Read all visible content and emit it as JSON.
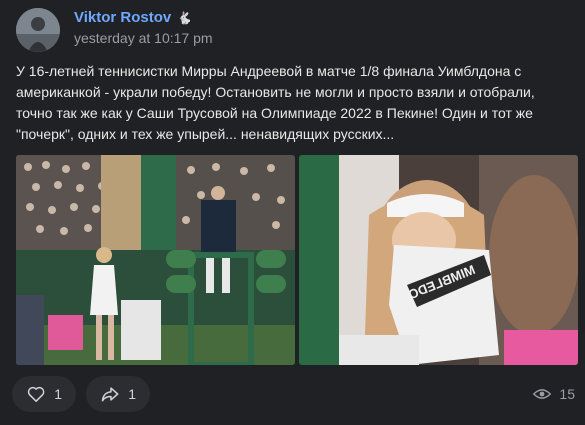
{
  "post": {
    "author": "Viktor Rostov",
    "author_badge": "🐇",
    "timestamp": "yesterday at 10:17 pm",
    "text": "У 16-летней теннисистки Мирры Андреевой в матче 1/8 финала Уимблдона с американкой - украли победу! Остановить не могли и просто взяли и отобрали, точно так же как у Саши Трусовой на Олимпиаде 2022 в Пекине! Один и тот же \"почерк\", одних и тех же упырей... ненавидящих русских...",
    "towel_text": "MIMBLEDON"
  },
  "actions": {
    "likes": "1",
    "shares": "1",
    "views": "15"
  },
  "icons": {
    "like": "heart-icon",
    "share": "share-arrow-icon",
    "views": "eye-icon"
  },
  "colors": {
    "background": "#1f2124",
    "author_link": "#6fa8ff",
    "button_bg": "#2b2d31"
  }
}
